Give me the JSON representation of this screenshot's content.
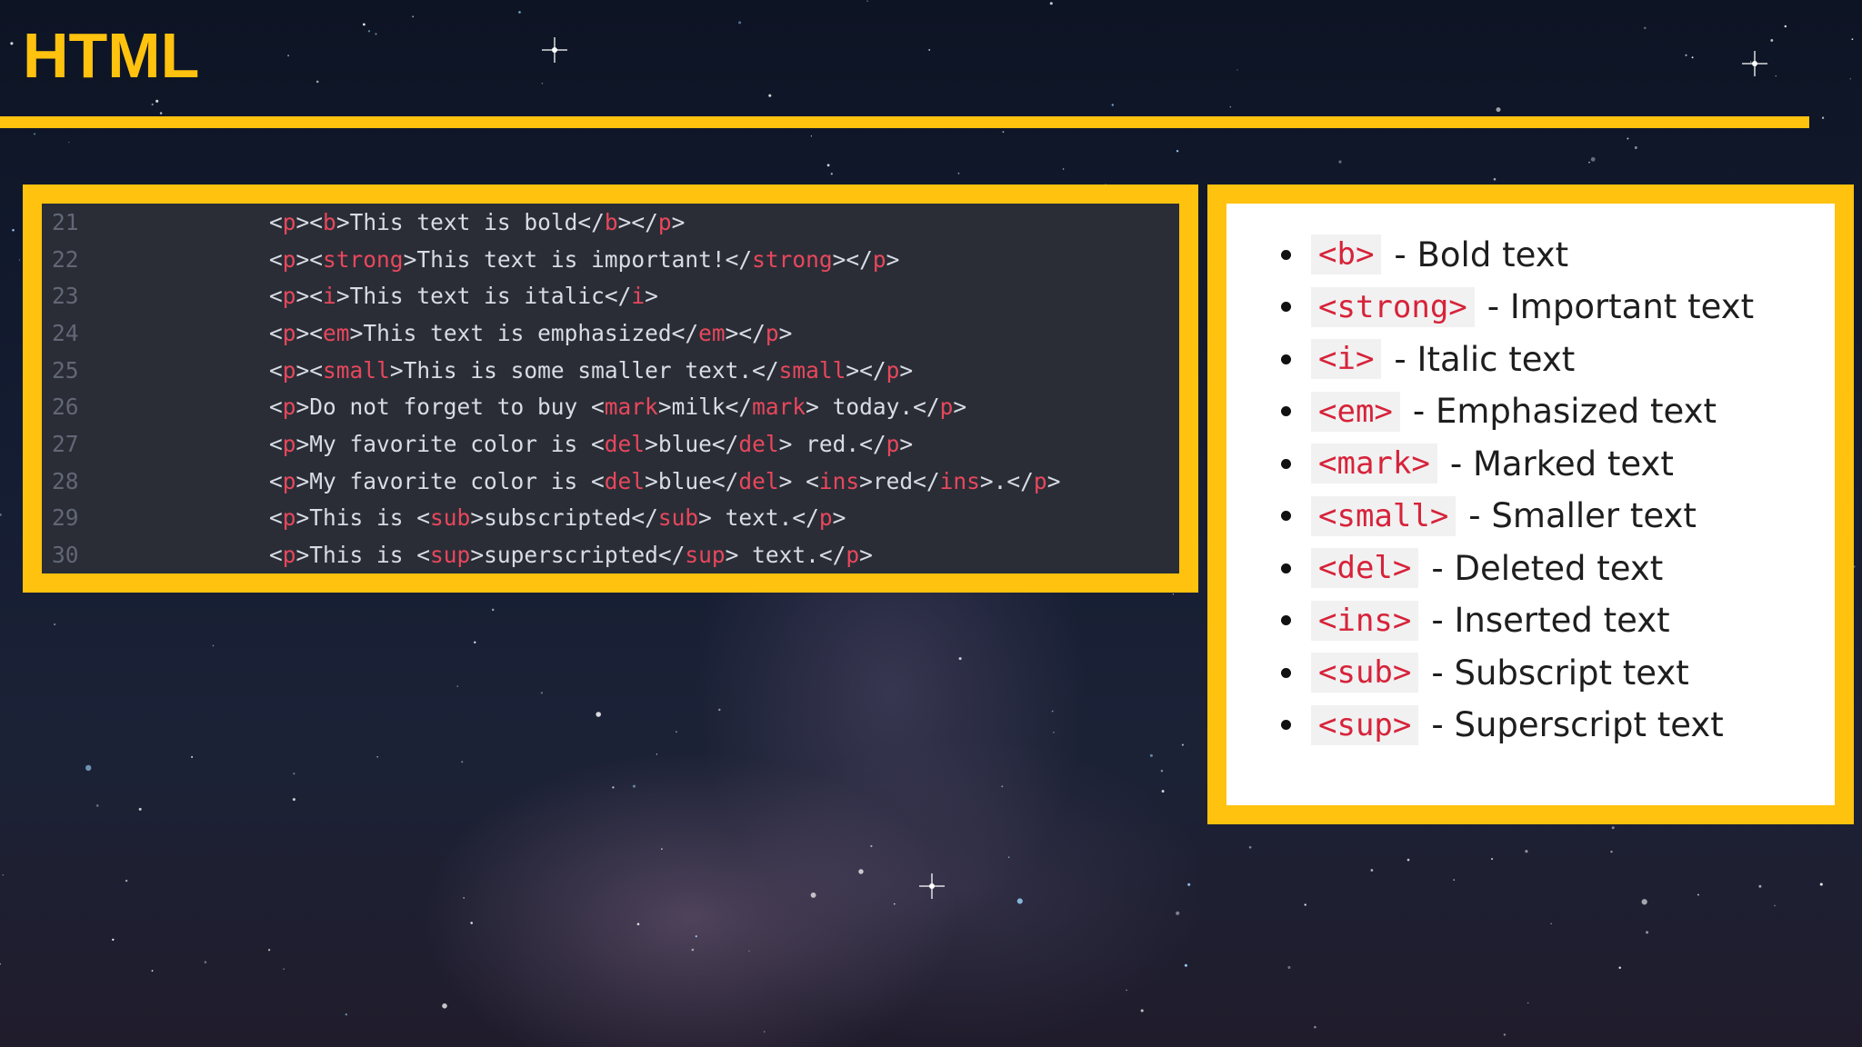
{
  "header": {
    "title": "HTML"
  },
  "code": {
    "lines": [
      {
        "number": "21",
        "tokens": [
          {
            "t": "<",
            "k": "brk"
          },
          {
            "t": "p",
            "k": "tag"
          },
          {
            "t": "><",
            "k": "brk"
          },
          {
            "t": "b",
            "k": "tag"
          },
          {
            "t": ">This text is bold</",
            "k": "brk"
          },
          {
            "t": "b",
            "k": "tag"
          },
          {
            "t": "></",
            "k": "brk"
          },
          {
            "t": "p",
            "k": "tag"
          },
          {
            "t": ">",
            "k": "brk"
          }
        ]
      },
      {
        "number": "22",
        "tokens": [
          {
            "t": "<",
            "k": "brk"
          },
          {
            "t": "p",
            "k": "tag"
          },
          {
            "t": "><",
            "k": "brk"
          },
          {
            "t": "strong",
            "k": "tag"
          },
          {
            "t": ">This text is important!</",
            "k": "brk"
          },
          {
            "t": "strong",
            "k": "tag"
          },
          {
            "t": "></",
            "k": "brk"
          },
          {
            "t": "p",
            "k": "tag"
          },
          {
            "t": ">",
            "k": "brk"
          }
        ]
      },
      {
        "number": "23",
        "tokens": [
          {
            "t": "<",
            "k": "brk"
          },
          {
            "t": "p",
            "k": "tag"
          },
          {
            "t": "><",
            "k": "brk"
          },
          {
            "t": "i",
            "k": "tag"
          },
          {
            "t": ">This text is italic</",
            "k": "brk"
          },
          {
            "t": "i",
            "k": "tag"
          },
          {
            "t": ">",
            "k": "brk"
          }
        ]
      },
      {
        "number": "24",
        "tokens": [
          {
            "t": "<",
            "k": "brk"
          },
          {
            "t": "p",
            "k": "tag"
          },
          {
            "t": "><",
            "k": "brk"
          },
          {
            "t": "em",
            "k": "tag"
          },
          {
            "t": ">This text is emphasized</",
            "k": "brk"
          },
          {
            "t": "em",
            "k": "tag"
          },
          {
            "t": "></",
            "k": "brk"
          },
          {
            "t": "p",
            "k": "tag"
          },
          {
            "t": ">",
            "k": "brk"
          }
        ]
      },
      {
        "number": "25",
        "tokens": [
          {
            "t": "<",
            "k": "brk"
          },
          {
            "t": "p",
            "k": "tag"
          },
          {
            "t": "><",
            "k": "brk"
          },
          {
            "t": "small",
            "k": "tag"
          },
          {
            "t": ">This is some smaller text.</",
            "k": "brk"
          },
          {
            "t": "small",
            "k": "tag"
          },
          {
            "t": "></",
            "k": "brk"
          },
          {
            "t": "p",
            "k": "tag"
          },
          {
            "t": ">",
            "k": "brk"
          }
        ]
      },
      {
        "number": "26",
        "tokens": [
          {
            "t": "<",
            "k": "brk"
          },
          {
            "t": "p",
            "k": "tag"
          },
          {
            "t": ">Do not forget to buy <",
            "k": "brk"
          },
          {
            "t": "mark",
            "k": "tag"
          },
          {
            "t": ">milk</",
            "k": "brk"
          },
          {
            "t": "mark",
            "k": "tag"
          },
          {
            "t": "> today.</",
            "k": "brk"
          },
          {
            "t": "p",
            "k": "tag"
          },
          {
            "t": ">",
            "k": "brk"
          }
        ]
      },
      {
        "number": "27",
        "tokens": [
          {
            "t": "<",
            "k": "brk"
          },
          {
            "t": "p",
            "k": "tag"
          },
          {
            "t": ">My favorite color is <",
            "k": "brk"
          },
          {
            "t": "del",
            "k": "tag"
          },
          {
            "t": ">blue</",
            "k": "brk"
          },
          {
            "t": "del",
            "k": "tag"
          },
          {
            "t": "> red.</",
            "k": "brk"
          },
          {
            "t": "p",
            "k": "tag"
          },
          {
            "t": ">",
            "k": "brk"
          }
        ]
      },
      {
        "number": "28",
        "tokens": [
          {
            "t": "<",
            "k": "brk"
          },
          {
            "t": "p",
            "k": "tag"
          },
          {
            "t": ">My favorite color is <",
            "k": "brk"
          },
          {
            "t": "del",
            "k": "tag"
          },
          {
            "t": ">blue</",
            "k": "brk"
          },
          {
            "t": "del",
            "k": "tag"
          },
          {
            "t": "> <",
            "k": "brk"
          },
          {
            "t": "ins",
            "k": "tag"
          },
          {
            "t": ">red</",
            "k": "brk"
          },
          {
            "t": "ins",
            "k": "tag"
          },
          {
            "t": ">.</",
            "k": "brk"
          },
          {
            "t": "p",
            "k": "tag"
          },
          {
            "t": ">",
            "k": "brk"
          }
        ]
      },
      {
        "number": "29",
        "tokens": [
          {
            "t": "<",
            "k": "brk"
          },
          {
            "t": "p",
            "k": "tag"
          },
          {
            "t": ">This is <",
            "k": "brk"
          },
          {
            "t": "sub",
            "k": "tag"
          },
          {
            "t": ">subscripted</",
            "k": "brk"
          },
          {
            "t": "sub",
            "k": "tag"
          },
          {
            "t": "> text.</",
            "k": "brk"
          },
          {
            "t": "p",
            "k": "tag"
          },
          {
            "t": ">",
            "k": "brk"
          }
        ]
      },
      {
        "number": "30",
        "tokens": [
          {
            "t": "<",
            "k": "brk"
          },
          {
            "t": "p",
            "k": "tag"
          },
          {
            "t": ">This is <",
            "k": "brk"
          },
          {
            "t": "sup",
            "k": "tag"
          },
          {
            "t": ">superscripted</",
            "k": "brk"
          },
          {
            "t": "sup",
            "k": "tag"
          },
          {
            "t": "> text.</",
            "k": "brk"
          },
          {
            "t": "p",
            "k": "tag"
          },
          {
            "t": ">",
            "k": "brk"
          }
        ]
      }
    ]
  },
  "reference_list": {
    "items": [
      {
        "tag": "<b>",
        "description": "- Bold text"
      },
      {
        "tag": "<strong>",
        "description": "- Important text"
      },
      {
        "tag": "<i>",
        "description": "- Italic text"
      },
      {
        "tag": "<em>",
        "description": "- Emphasized text"
      },
      {
        "tag": "<mark>",
        "description": "- Marked text"
      },
      {
        "tag": "<small>",
        "description": "- Smaller text"
      },
      {
        "tag": "<del>",
        "description": "- Deleted text"
      },
      {
        "tag": "<ins>",
        "description": "- Inserted text"
      },
      {
        "tag": "<sub>",
        "description": "- Subscript text"
      },
      {
        "tag": "<sup>",
        "description": "- Superscript text"
      }
    ]
  },
  "colors": {
    "accent": "#ffc20e",
    "code_background": "#2a2d36",
    "tag_red": "#e8475c",
    "badge_red": "#d6233a"
  }
}
